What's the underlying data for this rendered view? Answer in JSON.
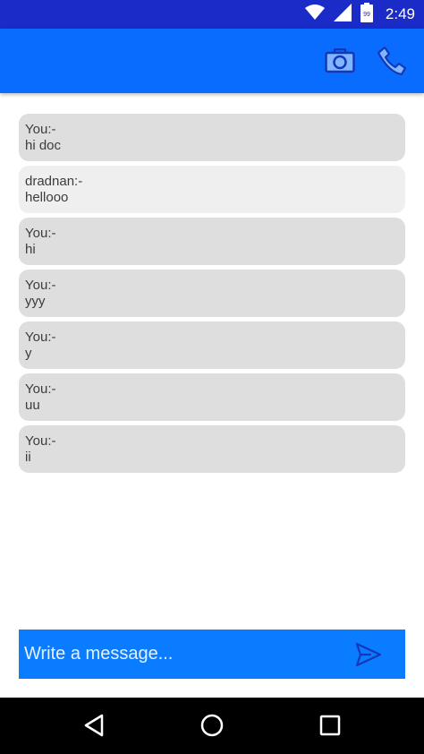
{
  "status_bar": {
    "time": "2:49",
    "battery_level": "99",
    "icons": [
      "wifi-icon",
      "signal-icon",
      "battery-icon"
    ]
  },
  "app_bar": {
    "actions": [
      {
        "name": "camera-icon"
      },
      {
        "name": "phone-icon"
      }
    ]
  },
  "messages": [
    {
      "sender": "You:-",
      "text": "hi doc",
      "self": true
    },
    {
      "sender": "dradnan:-",
      "text": "hellooo",
      "self": false
    },
    {
      "sender": "You:-",
      "text": "hi",
      "self": true
    },
    {
      "sender": "You:-",
      "text": "yyy",
      "self": true
    },
    {
      "sender": "You:-",
      "text": "y",
      "self": true
    },
    {
      "sender": "You:-",
      "text": "uu",
      "self": true
    },
    {
      "sender": "You:-",
      "text": "ii",
      "self": true
    }
  ],
  "composer": {
    "placeholder": "Write a message...",
    "value": "",
    "send_icon": "send-icon"
  },
  "nav_bar": {
    "buttons": [
      "back-icon",
      "home-icon",
      "recents-icon"
    ]
  },
  "colors": {
    "status_bar": "#1a2bc8",
    "app_bar": "#0a6cff",
    "composer": "#0a7cff",
    "bubble_self": "#dedede",
    "bubble_other": "#efefef"
  }
}
